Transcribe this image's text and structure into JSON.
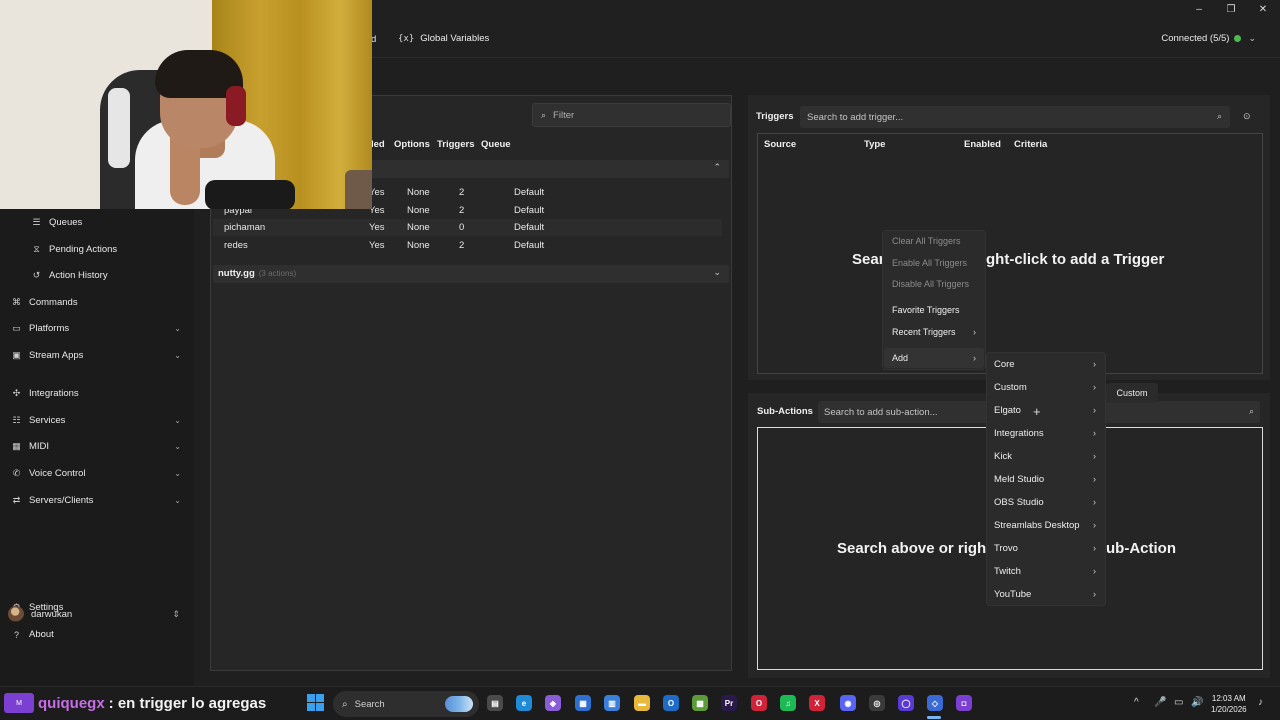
{
  "header": {
    "nav_partial": "d",
    "global_variables_icon": "{x}",
    "global_variables_label": "Global Variables",
    "connection_status": "Connected (5/5)",
    "connection_color": "#4cbb4c",
    "window_controls": [
      "–",
      "❐",
      "✕"
    ]
  },
  "sidebar": {
    "items": [
      {
        "label": "Queues",
        "icon": "queue-icon",
        "glyph": "☰"
      },
      {
        "label": "Pending Actions",
        "icon": "pending-icon",
        "glyph": "⧖"
      },
      {
        "label": "Action History",
        "icon": "history-icon",
        "glyph": "↺"
      },
      {
        "label": "Commands",
        "icon": "command-icon",
        "glyph": "⌘"
      },
      {
        "label": "Platforms",
        "icon": "platforms-icon",
        "glyph": "▭"
      },
      {
        "label": "Stream Apps",
        "icon": "stream-apps-icon",
        "glyph": "▣"
      },
      {
        "label": "Integrations",
        "icon": "integrations-icon",
        "glyph": "✣"
      },
      {
        "label": "Services",
        "icon": "services-icon",
        "glyph": "☷"
      },
      {
        "label": "MIDI",
        "icon": "midi-icon",
        "glyph": "▦"
      },
      {
        "label": "Voice Control",
        "icon": "voice-icon",
        "glyph": "✆"
      },
      {
        "label": "Servers/Clients",
        "icon": "servers-icon",
        "glyph": "⇄"
      },
      {
        "label": "Settings",
        "icon": "settings-icon",
        "glyph": "⚙"
      },
      {
        "label": "About",
        "icon": "about-icon",
        "glyph": "?"
      }
    ],
    "user": "darwukan"
  },
  "actions": {
    "filter_placeholder": "Filter",
    "columns": [
      "led",
      "Options",
      "Triggers",
      "Queue"
    ],
    "rows": [
      {
        "name": "",
        "enabled": "Yes",
        "options": "None",
        "triggers": "2",
        "queue": "Default"
      },
      {
        "name": "paypal",
        "enabled": "Yes",
        "options": "None",
        "triggers": "2",
        "queue": "Default"
      },
      {
        "name": "pichaman",
        "enabled": "Yes",
        "options": "None",
        "triggers": "0",
        "queue": "Default"
      },
      {
        "name": "redes",
        "enabled": "Yes",
        "options": "None",
        "triggers": "2",
        "queue": "Default"
      }
    ],
    "group_name": "nutty.gg",
    "group_count": "(3 actions)"
  },
  "triggers": {
    "title": "Triggers",
    "search_placeholder": "Search to add trigger...",
    "columns": [
      "Source",
      "Type",
      "Enabled",
      "Criteria"
    ],
    "hint_left": "Sear",
    "hint_right": "ght-click to add a Trigger"
  },
  "context_menu": {
    "items": [
      {
        "label": "Clear All Triggers",
        "disabled": true
      },
      {
        "label": "Enable All Triggers",
        "disabled": true
      },
      {
        "label": "Disable All Triggers",
        "disabled": true
      },
      {
        "label": "Favorite Triggers",
        "disabled": false
      },
      {
        "label": "Recent Triggers",
        "disabled": false,
        "submenu": true
      },
      {
        "label": "Add",
        "disabled": false,
        "submenu": true
      }
    ]
  },
  "add_submenu": {
    "items": [
      "Core",
      "Custom",
      "Elgato",
      "Integrations",
      "Kick",
      "Meld Studio",
      "OBS Studio",
      "Streamlabs Desktop",
      "Trovo",
      "Twitch",
      "YouTube"
    ],
    "tooltip": "Custom"
  },
  "subactions": {
    "title": "Sub-Actions",
    "search_placeholder": "Search to add sub-action...",
    "hint_left": "Search above or righ",
    "hint_right": "ub-Action"
  },
  "overlay": {
    "badge": "M",
    "chat_user": "quiquegx",
    "chat_message": ": en trigger lo agregas"
  },
  "taskbar": {
    "search_placeholder": "Search",
    "time": "12:03 AM",
    "date": "1/20/2026",
    "apps": [
      {
        "name": "files-app",
        "glyph": "▤",
        "color": "#4a4a4a"
      },
      {
        "name": "edge-app",
        "glyph": "e",
        "color": "#1f8ad6"
      },
      {
        "name": "copilot-app",
        "glyph": "◆",
        "color": "#8a5cd6"
      },
      {
        "name": "calendar-app",
        "glyph": "▦",
        "color": "#2e6fd0"
      },
      {
        "name": "store-app",
        "glyph": "▥",
        "color": "#3a7fd9"
      },
      {
        "name": "explorer-app",
        "glyph": "▬",
        "color": "#e8b83a"
      },
      {
        "name": "outlook-app",
        "glyph": "O",
        "color": "#1d6cc8"
      },
      {
        "name": "minecraft-app",
        "glyph": "▩",
        "color": "#5d9b3a"
      },
      {
        "name": "premiere-app",
        "glyph": "Pr",
        "color": "#2a1a4a"
      },
      {
        "name": "opera-app",
        "glyph": "O",
        "color": "#d0233a"
      },
      {
        "name": "spotify-app",
        "glyph": "♫",
        "color": "#1db954"
      },
      {
        "name": "x-app",
        "glyph": "X",
        "color": "#d0233a"
      },
      {
        "name": "discord-app",
        "glyph": "◉",
        "color": "#5865f2"
      },
      {
        "name": "chrome-app",
        "glyph": "◎",
        "color": "#3a3a3a"
      },
      {
        "name": "circle-app",
        "glyph": "◯",
        "color": "#5a3ad6"
      },
      {
        "name": "streamerbot-app",
        "glyph": "◇",
        "color": "#3a6ad6"
      },
      {
        "name": "twitch-app",
        "glyph": "◘",
        "color": "#7b3fd1"
      }
    ],
    "tray": [
      "^",
      "🎤",
      "▭",
      "🔊",
      "🔋"
    ]
  }
}
